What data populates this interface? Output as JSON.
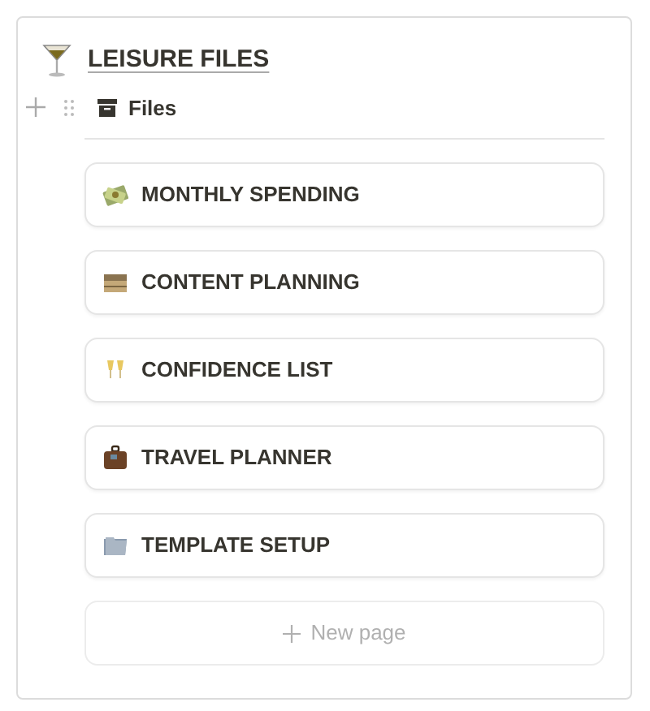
{
  "page": {
    "title": "LEISURE FILES"
  },
  "view": {
    "label": "Files"
  },
  "cards": [
    {
      "title": "MONTHLY SPENDING"
    },
    {
      "title": "CONTENT PLANNING"
    },
    {
      "title": "CONFIDENCE LIST"
    },
    {
      "title": "TRAVEL PLANNER"
    },
    {
      "title": "TEMPLATE SETUP"
    }
  ],
  "new_page": {
    "label": "New page"
  }
}
